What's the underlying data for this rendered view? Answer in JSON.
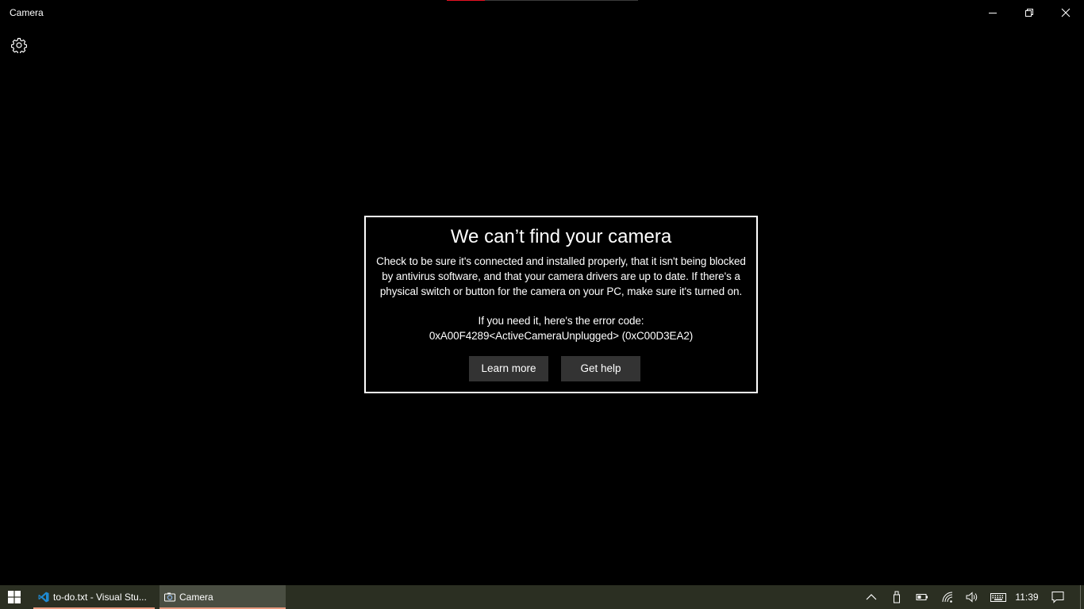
{
  "window": {
    "title": "Camera"
  },
  "progress": {
    "fraction": 0.2,
    "accent": "#e81123"
  },
  "dialog": {
    "title": "We can’t find your camera",
    "lines": [
      "Check to be sure it's connected and installed properly, that it isn't being blocked",
      "by antivirus software, and that your camera drivers are up to date. If there's a",
      "physical switch or button for the camera on your PC, make sure it's turned on."
    ],
    "error_intro": "If you need it, here's the error code:",
    "error_code": "0xA00F4289<ActiveCameraUnplugged> (0xC00D3EA2)",
    "learn_more_label": "Learn more",
    "get_help_label": "Get help"
  },
  "taskbar": {
    "items": [
      {
        "label": "to-do.txt - Visual Stu...",
        "icon": "vscode-icon"
      },
      {
        "label": "Camera",
        "icon": "camera-icon"
      }
    ],
    "clock": "11:39",
    "accent": "#e89a7f",
    "background": "#2b2f22"
  }
}
